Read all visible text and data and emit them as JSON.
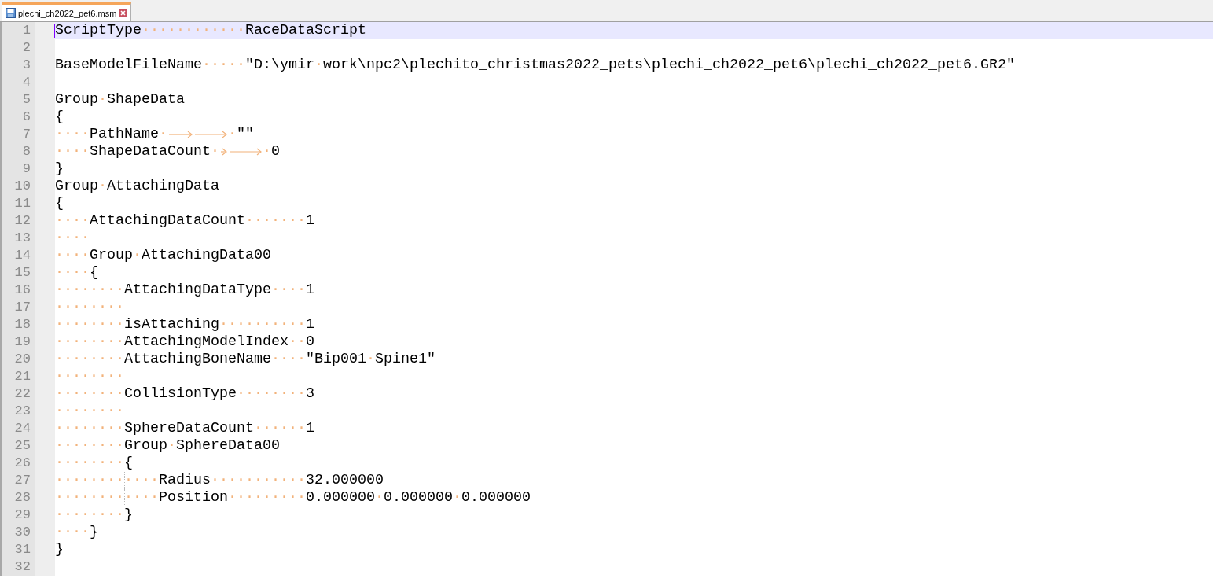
{
  "tabs": [
    {
      "label": "plechi_ch2022_pet6.msm",
      "selected": true
    }
  ],
  "lines": [
    {
      "number": "1",
      "current": true,
      "segments": [
        {
          "kind": "code",
          "text": "ScriptType"
        },
        {
          "kind": "ws",
          "text": "············"
        },
        {
          "kind": "code",
          "text": "RaceDataScript"
        }
      ]
    },
    {
      "number": "2",
      "current": false
    },
    {
      "number": "3",
      "current": false,
      "segments": [
        {
          "kind": "code",
          "text": "BaseModelFileName"
        },
        {
          "kind": "ws",
          "text": "·····"
        },
        {
          "kind": "code",
          "text": "\"D:\\ymir"
        },
        {
          "kind": "ws",
          "text": "·"
        },
        {
          "kind": "code",
          "text": "work\\npc2\\plechito_christmas2022_pets\\plechi_ch2022_pet6\\plechi_ch2022_pet6.GR2\""
        }
      ]
    },
    {
      "number": "4",
      "current": false
    },
    {
      "number": "5",
      "current": false,
      "segments": [
        {
          "kind": "code",
          "text": "Group"
        },
        {
          "kind": "ws",
          "text": "·"
        },
        {
          "kind": "code",
          "text": "ShapeData"
        }
      ]
    },
    {
      "number": "6",
      "current": false,
      "segments": [
        {
          "kind": "code",
          "text": "{"
        }
      ]
    },
    {
      "number": "7",
      "current": false,
      "segments": [
        {
          "kind": "ws",
          "text": "····"
        },
        {
          "kind": "code",
          "text": "PathName"
        },
        {
          "kind": "ws",
          "text": "·"
        },
        {
          "kind": "tab"
        },
        {
          "kind": "tab"
        },
        {
          "kind": "ws",
          "text": "·"
        },
        {
          "kind": "code",
          "text": "\"\""
        }
      ]
    },
    {
      "number": "8",
      "current": false,
      "segments": [
        {
          "kind": "ws",
          "text": "····"
        },
        {
          "kind": "code",
          "text": "ShapeDataCount"
        },
        {
          "kind": "ws",
          "text": "·"
        },
        {
          "kind": "tab"
        },
        {
          "kind": "tab"
        },
        {
          "kind": "ws",
          "text": "·"
        },
        {
          "kind": "code",
          "text": "0"
        }
      ]
    },
    {
      "number": "9",
      "current": false,
      "segments": [
        {
          "kind": "code",
          "text": "}"
        }
      ]
    },
    {
      "number": "10",
      "current": false,
      "segments": [
        {
          "kind": "code",
          "text": "Group"
        },
        {
          "kind": "ws",
          "text": "·"
        },
        {
          "kind": "code",
          "text": "AttachingData"
        }
      ]
    },
    {
      "number": "11",
      "current": false,
      "segments": [
        {
          "kind": "code",
          "text": "{"
        }
      ]
    },
    {
      "number": "12",
      "current": false,
      "segments": [
        {
          "kind": "ws",
          "text": "····"
        },
        {
          "kind": "code",
          "text": "AttachingDataCount"
        },
        {
          "kind": "ws",
          "text": "·······"
        },
        {
          "kind": "code",
          "text": "1"
        }
      ]
    },
    {
      "number": "13",
      "current": false,
      "segments": [
        {
          "kind": "ws",
          "text": "····"
        }
      ]
    },
    {
      "number": "14",
      "current": false,
      "segments": [
        {
          "kind": "ws",
          "text": "····"
        },
        {
          "kind": "code",
          "text": "Group"
        },
        {
          "kind": "ws",
          "text": "·"
        },
        {
          "kind": "code",
          "text": "AttachingData00"
        }
      ]
    },
    {
      "number": "15",
      "current": false,
      "segments": [
        {
          "kind": "ws",
          "text": "····"
        },
        {
          "kind": "code",
          "text": "{"
        }
      ]
    },
    {
      "number": "16",
      "current": false,
      "segments": [
        {
          "kind": "ws",
          "text": "········"
        },
        {
          "kind": "code",
          "text": "AttachingDataType"
        },
        {
          "kind": "ws",
          "text": "····"
        },
        {
          "kind": "code",
          "text": "1"
        }
      ]
    },
    {
      "number": "17",
      "current": false,
      "segments": [
        {
          "kind": "ws",
          "text": "········"
        }
      ]
    },
    {
      "number": "18",
      "current": false,
      "segments": [
        {
          "kind": "ws",
          "text": "········"
        },
        {
          "kind": "code",
          "text": "isAttaching"
        },
        {
          "kind": "ws",
          "text": "··········"
        },
        {
          "kind": "code",
          "text": "1"
        }
      ]
    },
    {
      "number": "19",
      "current": false,
      "segments": [
        {
          "kind": "ws",
          "text": "········"
        },
        {
          "kind": "code",
          "text": "AttachingModelIndex"
        },
        {
          "kind": "ws",
          "text": "··"
        },
        {
          "kind": "code",
          "text": "0"
        }
      ]
    },
    {
      "number": "20",
      "current": false,
      "segments": [
        {
          "kind": "ws",
          "text": "········"
        },
        {
          "kind": "code",
          "text": "AttachingBoneName"
        },
        {
          "kind": "ws",
          "text": "····"
        },
        {
          "kind": "code",
          "text": "\"Bip001"
        },
        {
          "kind": "ws",
          "text": "·"
        },
        {
          "kind": "code",
          "text": "Spine1\""
        }
      ]
    },
    {
      "number": "21",
      "current": false,
      "segments": [
        {
          "kind": "ws",
          "text": "········"
        }
      ]
    },
    {
      "number": "22",
      "current": false,
      "segments": [
        {
          "kind": "ws",
          "text": "········"
        },
        {
          "kind": "code",
          "text": "CollisionType"
        },
        {
          "kind": "ws",
          "text": "········"
        },
        {
          "kind": "code",
          "text": "3"
        }
      ]
    },
    {
      "number": "23",
      "current": false,
      "segments": [
        {
          "kind": "ws",
          "text": "········"
        }
      ]
    },
    {
      "number": "24",
      "current": false,
      "segments": [
        {
          "kind": "ws",
          "text": "········"
        },
        {
          "kind": "code",
          "text": "SphereDataCount"
        },
        {
          "kind": "ws",
          "text": "······"
        },
        {
          "kind": "code",
          "text": "1"
        }
      ]
    },
    {
      "number": "25",
      "current": false,
      "segments": [
        {
          "kind": "ws",
          "text": "········"
        },
        {
          "kind": "code",
          "text": "Group"
        },
        {
          "kind": "ws",
          "text": "·"
        },
        {
          "kind": "code",
          "text": "SphereData00"
        }
      ]
    },
    {
      "number": "26",
      "current": false,
      "segments": [
        {
          "kind": "ws",
          "text": "········"
        },
        {
          "kind": "code",
          "text": "{"
        }
      ]
    },
    {
      "number": "27",
      "current": false,
      "segments": [
        {
          "kind": "ws",
          "text": "············"
        },
        {
          "kind": "code",
          "text": "Radius"
        },
        {
          "kind": "ws",
          "text": "···········"
        },
        {
          "kind": "code",
          "text": "32.000000"
        }
      ]
    },
    {
      "number": "28",
      "current": false,
      "segments": [
        {
          "kind": "ws",
          "text": "············"
        },
        {
          "kind": "code",
          "text": "Position"
        },
        {
          "kind": "ws",
          "text": "·········"
        },
        {
          "kind": "code",
          "text": "0.000000"
        },
        {
          "kind": "ws",
          "text": "·"
        },
        {
          "kind": "code",
          "text": "0.000000"
        },
        {
          "kind": "ws",
          "text": "·"
        },
        {
          "kind": "code",
          "text": "0.000000"
        }
      ]
    },
    {
      "number": "29",
      "current": false,
      "segments": [
        {
          "kind": "ws",
          "text": "········"
        },
        {
          "kind": "code",
          "text": "}"
        }
      ]
    },
    {
      "number": "30",
      "current": false,
      "segments": [
        {
          "kind": "ws",
          "text": "····"
        },
        {
          "kind": "code",
          "text": "}"
        }
      ]
    },
    {
      "number": "31",
      "current": false,
      "segments": [
        {
          "kind": "code",
          "text": "}"
        }
      ]
    },
    {
      "number": "32",
      "current": false
    }
  ]
}
